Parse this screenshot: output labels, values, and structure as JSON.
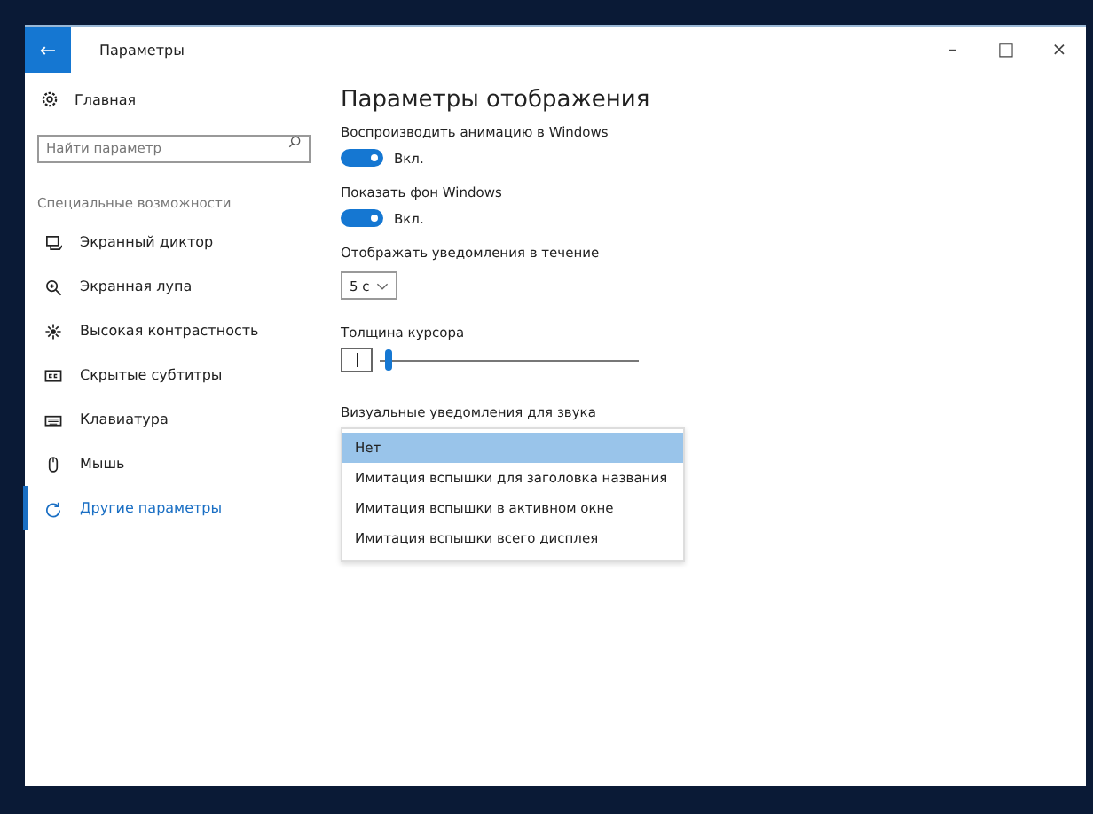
{
  "window": {
    "back": "←",
    "title": "Параметры",
    "controls": [
      "–",
      "□",
      "×"
    ]
  },
  "sidebar": {
    "home": "Главная",
    "search": {
      "placeholder": "Найти параметр"
    },
    "section": "Специальные возможности",
    "items": [
      {
        "label": "Экранный диктор",
        "selected": false
      },
      {
        "label": "Экранная лупа",
        "selected": false
      },
      {
        "label": "Высокая контрастность",
        "selected": false
      },
      {
        "label": "Скрытые субтитры",
        "selected": false
      },
      {
        "label": "Клавиатура",
        "selected": false
      },
      {
        "label": "Мышь",
        "selected": false
      },
      {
        "label": "Другие параметры",
        "selected": true
      }
    ]
  },
  "content": {
    "title": "Параметры отображения",
    "toggles": [
      {
        "label": "Воспроизводить анимацию в Windows",
        "on": true,
        "state": "Вкл."
      },
      {
        "label": "Показать фон Windows",
        "on": true,
        "state": "Вкл."
      }
    ],
    "duration": {
      "label": "Отображать уведомления в течение",
      "value": "5 с"
    },
    "cursor": {
      "label": "Толщина курсора",
      "level": 0.02
    },
    "sound": {
      "label": "Визуальные уведомления для звука",
      "options": [
        {
          "label": "Нет",
          "selected": true
        },
        {
          "label": "Имитация вспышки для заголовка названия",
          "selected": false
        },
        {
          "label": "Имитация вспышки в активном окне",
          "selected": false
        },
        {
          "label": "Имитация вспышки всего дисплея",
          "selected": false
        }
      ]
    }
  }
}
